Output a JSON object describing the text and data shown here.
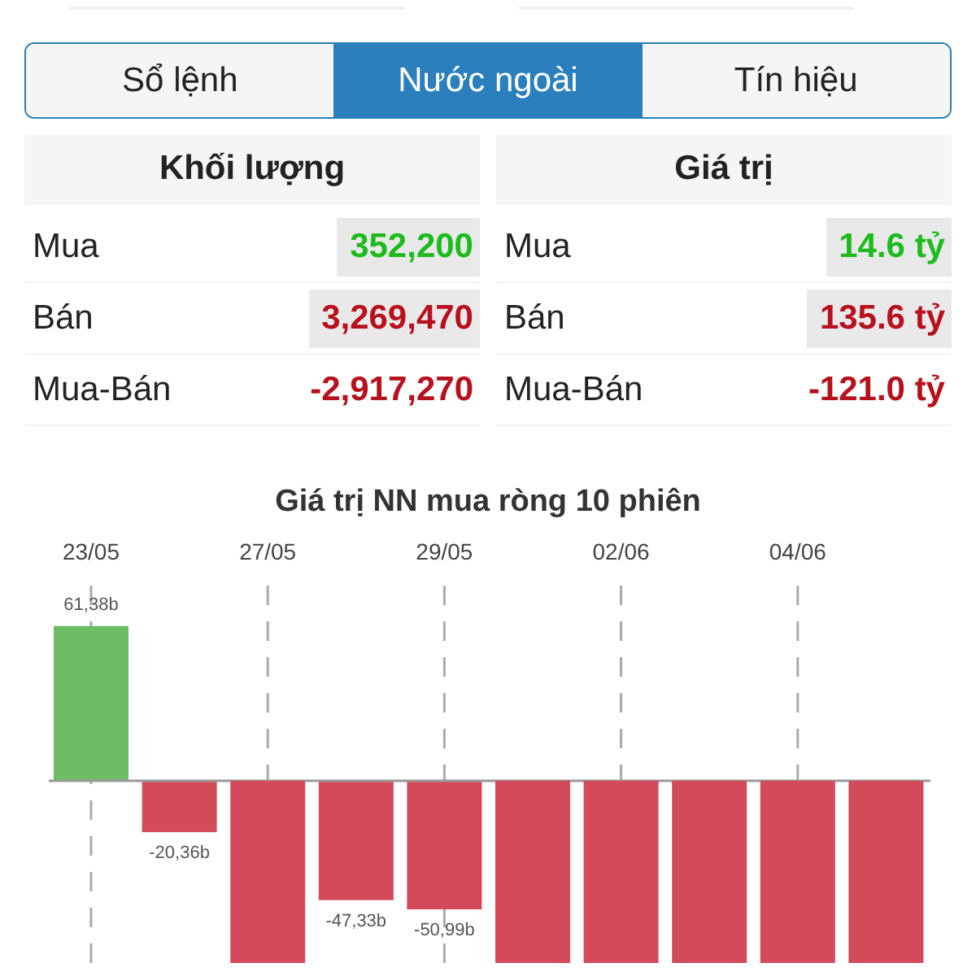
{
  "tabs": [
    {
      "label": "Sổ lệnh",
      "selected": false
    },
    {
      "label": "Nước ngoài",
      "selected": true
    },
    {
      "label": "Tín hiệu",
      "selected": false
    }
  ],
  "tables": [
    {
      "title": "Khối lượng",
      "rows": [
        {
          "label": "Mua",
          "value": "352,200",
          "kind": "up",
          "highlighted": true
        },
        {
          "label": "Bán",
          "value": "3,269,470",
          "kind": "down",
          "highlighted": true
        },
        {
          "label": "Mua-Bán",
          "value": "-2,917,270",
          "kind": "down",
          "highlighted": false
        }
      ]
    },
    {
      "title": "Giá trị",
      "rows": [
        {
          "label": "Mua",
          "value": "14.6 tỷ",
          "kind": "up",
          "highlighted": true
        },
        {
          "label": "Bán",
          "value": "135.6 tỷ",
          "kind": "down",
          "highlighted": true
        },
        {
          "label": "Mua-Bán",
          "value": "-121.0 tỷ",
          "kind": "down",
          "highlighted": false
        }
      ]
    }
  ],
  "chart_data": {
    "type": "bar",
    "title": "Giá trị NN mua ròng 10 phiên",
    "categories": [
      "23/05",
      null,
      "27/05",
      null,
      "29/05",
      null,
      "02/06",
      null,
      "04/06",
      null
    ],
    "values": [
      61.38,
      -20.36,
      null,
      -47.33,
      -50.99,
      null,
      null,
      null,
      null,
      null
    ],
    "value_labels": [
      "61,38b",
      "-20,36b",
      null,
      "-47,33b",
      "-50,99b",
      null,
      null,
      null,
      null,
      null
    ],
    "grid": true
  }
}
